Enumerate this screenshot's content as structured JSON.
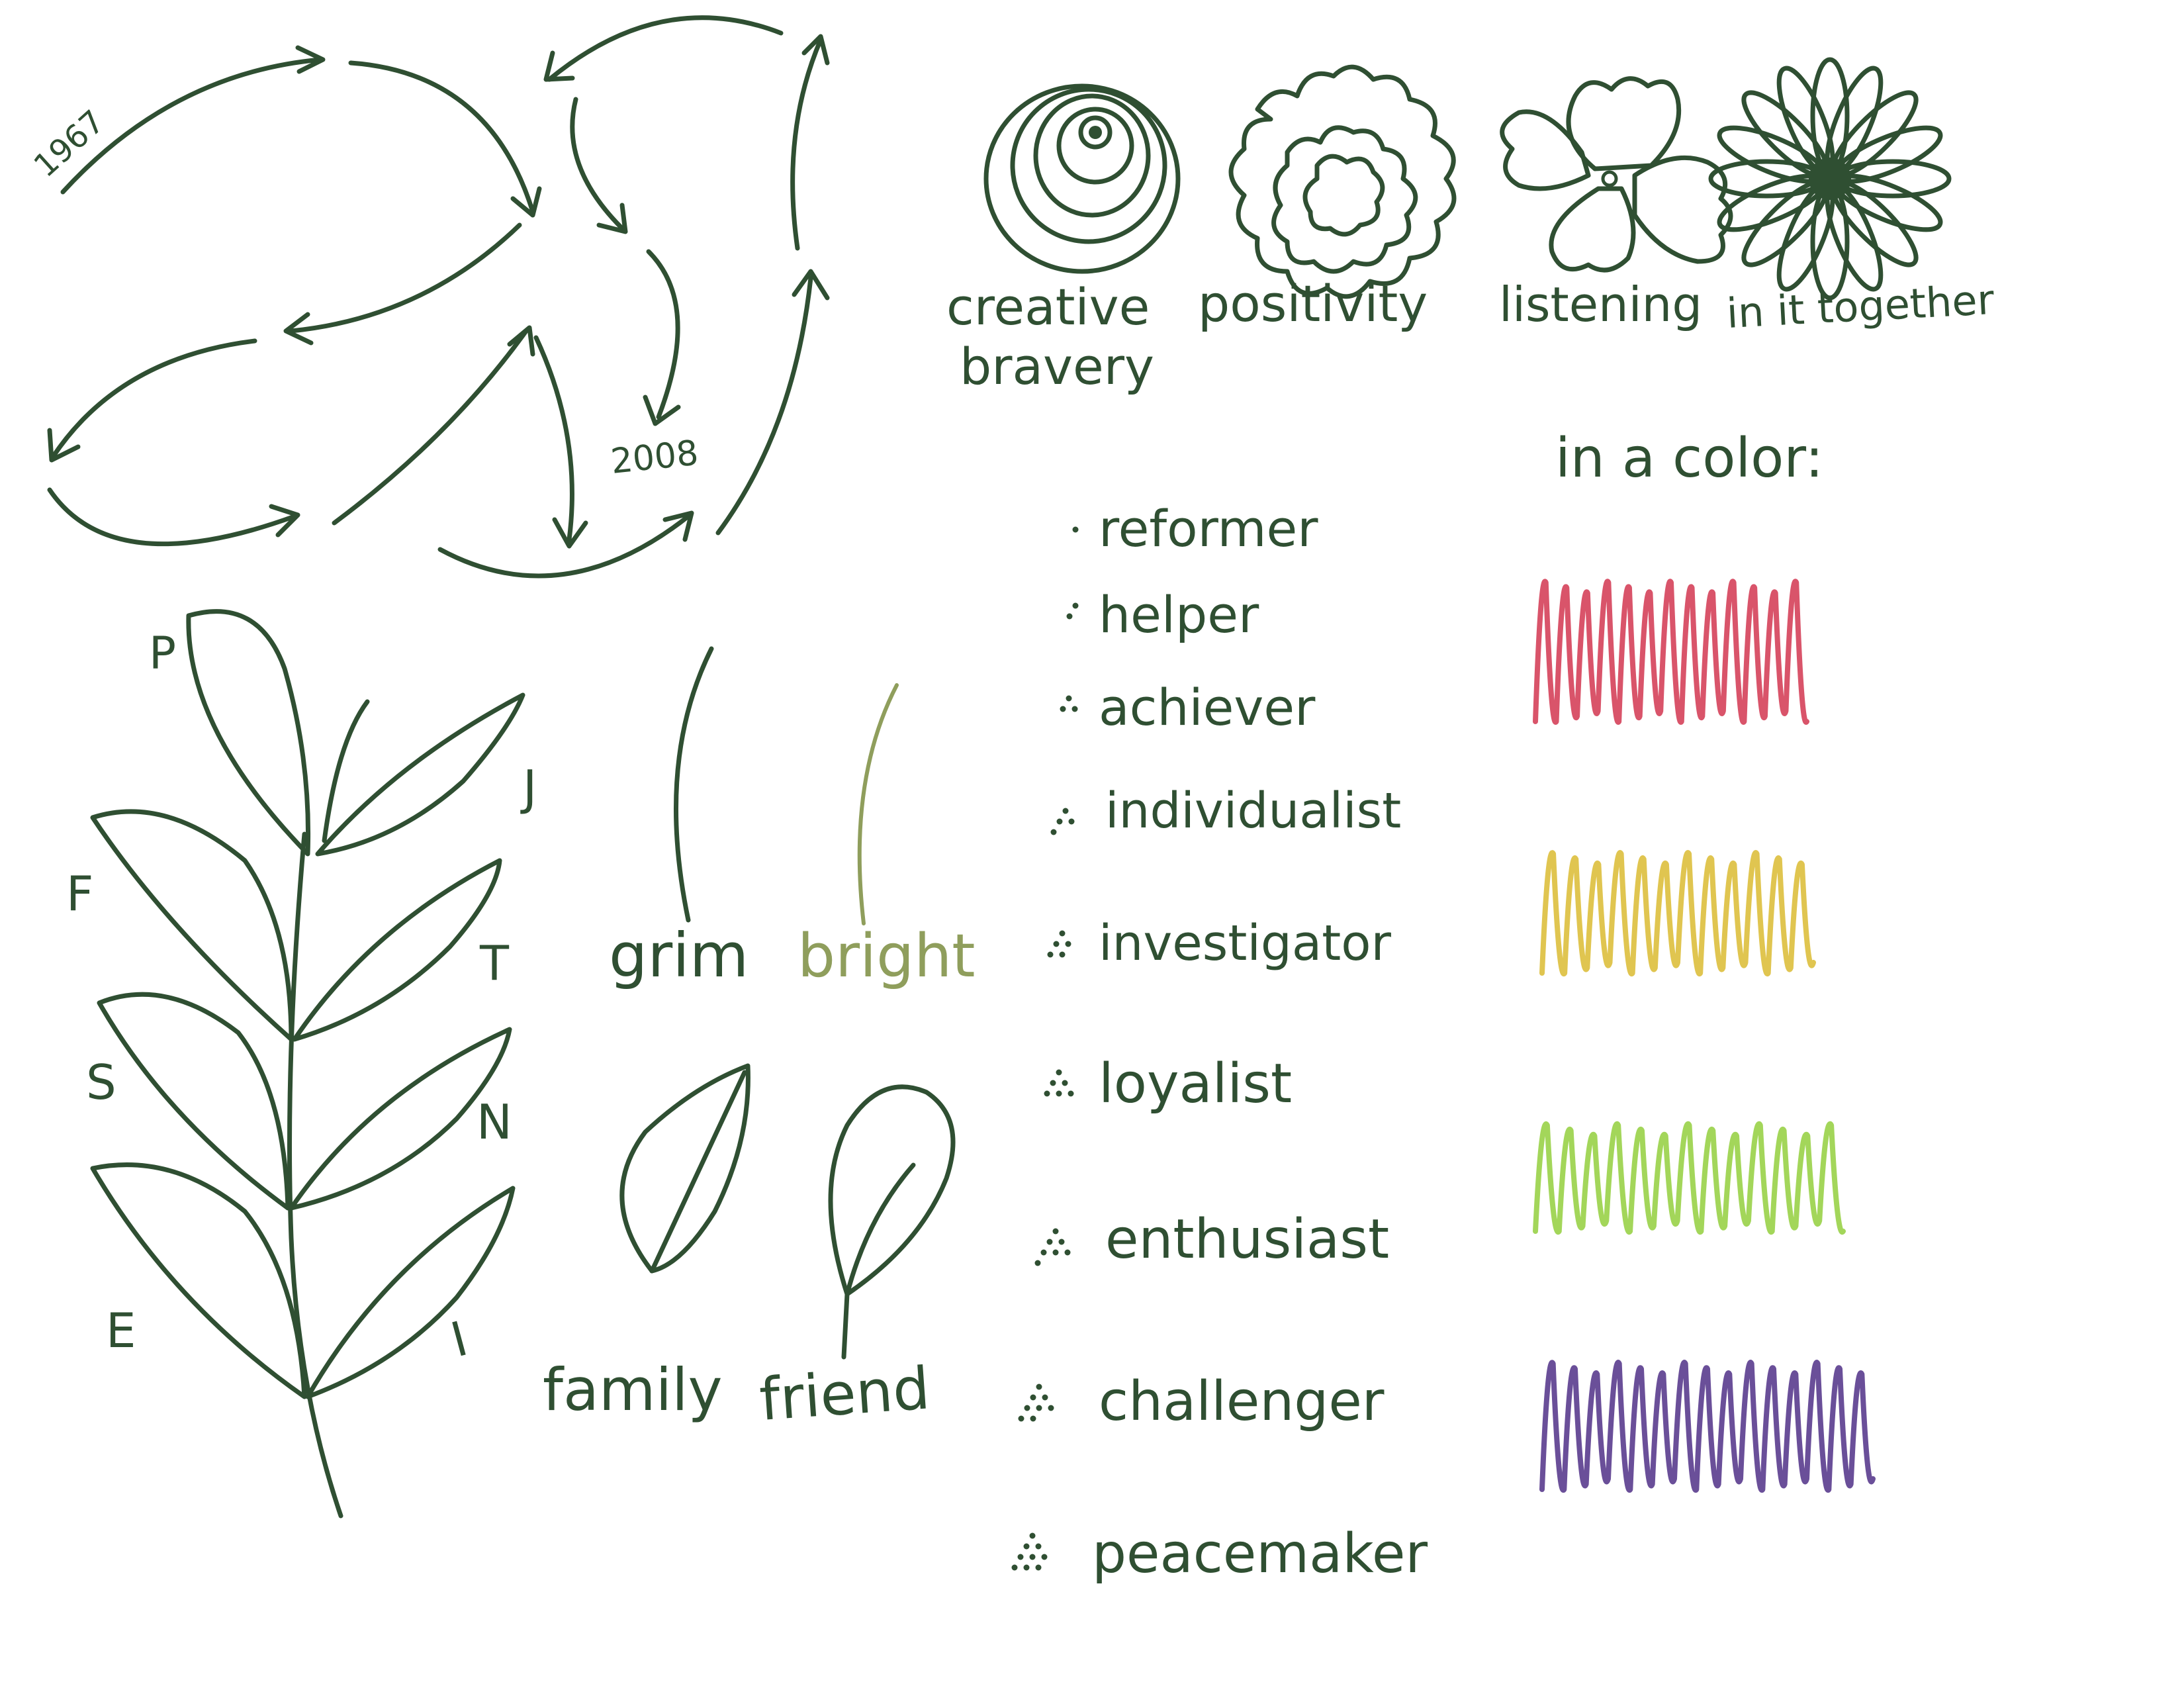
{
  "colors": {
    "ink": "#2f4f32",
    "bright": "#8f9e5c",
    "red": "#d9546a",
    "yellow": "#e0c550",
    "green": "#a3d65a",
    "purple": "#6a4f99"
  },
  "timeline": {
    "start_year": "1967",
    "end_year": "2008"
  },
  "flowers": [
    {
      "label": "creative",
      "label2": "bravery",
      "icon": "spiral-rose-icon"
    },
    {
      "label": "positivity",
      "icon": "ruffled-flower-icon"
    },
    {
      "label": "listening",
      "icon": "four-petal-flower-icon"
    },
    {
      "label": "in it together",
      "icon": "daisy-icon"
    }
  ],
  "fern": {
    "letters": [
      "P",
      "J",
      "F",
      "T",
      "S",
      "N",
      "E",
      "I"
    ]
  },
  "words": {
    "grim": "grim",
    "bright": "bright",
    "family": "family",
    "friend": "friend"
  },
  "types": [
    {
      "label": "reformer",
      "dots": 1
    },
    {
      "label": "helper",
      "dots": 2
    },
    {
      "label": "achiever",
      "dots": 3
    },
    {
      "label": "individualist",
      "dots": 4
    },
    {
      "label": "investigator",
      "dots": 5
    },
    {
      "label": "loyalist",
      "dots": 6
    },
    {
      "label": "enthusiast",
      "dots": 7
    },
    {
      "label": "challenger",
      "dots": 8
    },
    {
      "label": "peacemaker",
      "dots": 9
    }
  ],
  "color_section": {
    "title": "in a color:",
    "swatches": [
      "red",
      "yellow",
      "green",
      "purple"
    ]
  }
}
